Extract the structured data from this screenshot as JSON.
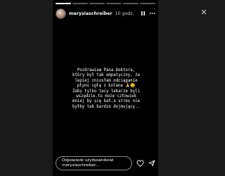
{
  "story": {
    "username": "marysiaschreiber",
    "time": "10 godz.",
    "caption": "Pozdrawiam Pana Doktora,\nktóry był tak empatyczny, że\nlepiej zniosłam odciąganie\npłynu igłą z kolana 🙏😉\nŻeby tylko tacy lekarze byli\nwszędzie.to może człowiek\nmniej by się bał.a stres nie\nbyłby tak bardzo dojmujący..",
    "reply_placeholder": "Odpowiedz użytkownikowi marysiaschreiber…",
    "progress_segments": 6,
    "active_segment": 1
  },
  "icons": {
    "pause": "pause-icon",
    "more": "more-options-icon",
    "heart": "heart-icon",
    "send": "send-icon",
    "close": "close-icon",
    "prev": "chevron-left-icon",
    "next": "chevron-right-icon"
  },
  "colors": {
    "background": "#1a1a1a",
    "story_background": "#000000",
    "text": "#ffffff"
  }
}
